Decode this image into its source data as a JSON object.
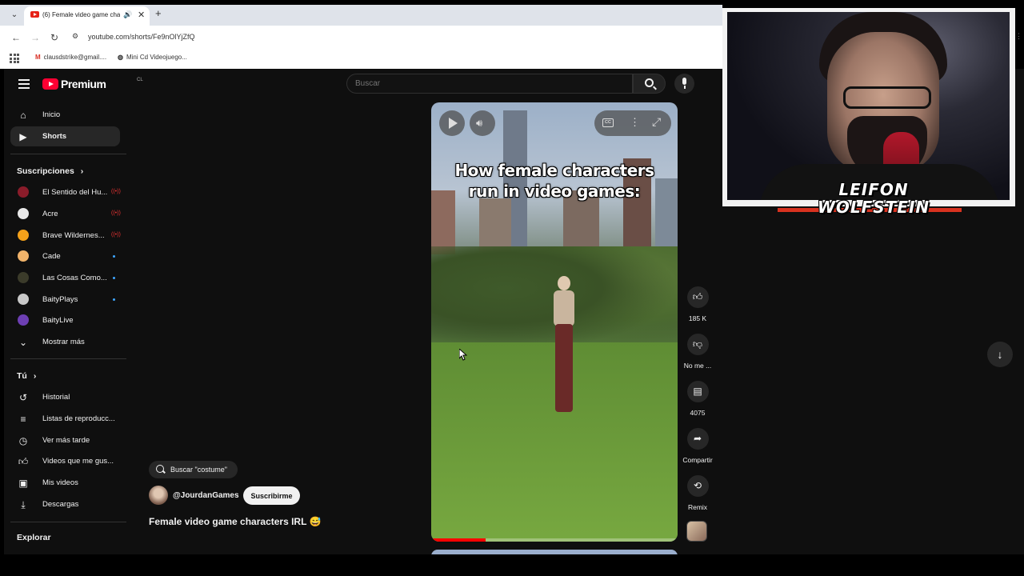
{
  "browser": {
    "tab_title": "(6) Female video game cha",
    "url": "youtube.com/shorts/Fe9nOlYjZfQ",
    "bookmarks": [
      {
        "label": "clausdstrike@gmail....",
        "icon": "gmail-icon"
      },
      {
        "label": "Mini Cd Videojuego...",
        "icon": "globe-icon"
      }
    ]
  },
  "header": {
    "logo_text": "Premium",
    "logo_country": "CL",
    "search_placeholder": "Buscar"
  },
  "sidebar": {
    "main": [
      {
        "label": "Inicio",
        "icon": "home-icon"
      },
      {
        "label": "Shorts",
        "icon": "shorts-icon",
        "active": true
      }
    ],
    "subscriptions_title": "Suscripciones",
    "subscriptions": [
      {
        "label": "El Sentido del Hu...",
        "status": "live"
      },
      {
        "label": "Acre",
        "status": "live"
      },
      {
        "label": "Brave Wildernes...",
        "status": "live"
      },
      {
        "label": "Cade",
        "status": "new"
      },
      {
        "label": "Las Cosas Como...",
        "status": "new"
      },
      {
        "label": "BaityPlays",
        "status": "new"
      },
      {
        "label": "BaityLive",
        "status": "none"
      }
    ],
    "show_more": "Mostrar más",
    "you_title": "Tú",
    "you_items": [
      {
        "label": "Historial",
        "icon": "history-icon"
      },
      {
        "label": "Listas de reproducc...",
        "icon": "playlist-icon"
      },
      {
        "label": "Ver más tarde",
        "icon": "clock-icon"
      },
      {
        "label": "Videos que me gus...",
        "icon": "like-icon"
      },
      {
        "label": "Mis videos",
        "icon": "video-icon"
      },
      {
        "label": "Descargas",
        "icon": "download-icon"
      }
    ],
    "explore_title": "Explorar"
  },
  "short": {
    "caption_line1": "How female characters",
    "caption_line2": "run in video games:",
    "progress": 0.22,
    "search_chip": "Buscar \"costume\"",
    "channel": "@JourdanGames",
    "subscribe_label": "Suscribirme",
    "title": "Female video game characters IRL 😅"
  },
  "actions": {
    "likes": "185 K",
    "dislike": "No me ...",
    "comments": "4075",
    "share": "Compartir",
    "remix": "Remix"
  },
  "overlay": {
    "logo_line1": "LEIFON",
    "logo_line2": "WOLFSTEIN"
  }
}
